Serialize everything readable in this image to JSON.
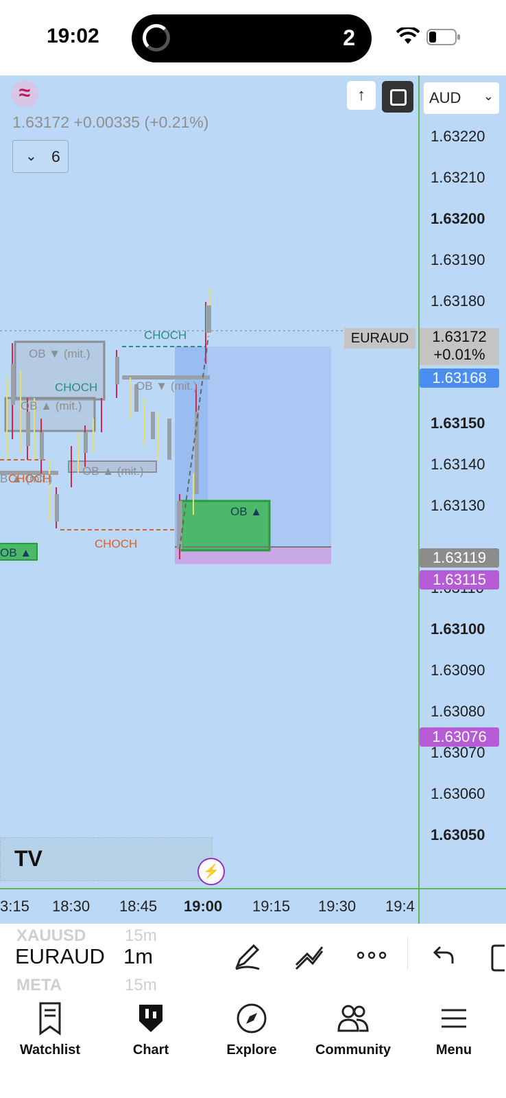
{
  "status": {
    "time": "19:02",
    "notification_count": "2"
  },
  "header": {
    "quote": "1.63172  +0.00335 (+0.21%)",
    "indicator_count": "6",
    "currency": "AUD",
    "up_arrow": "↑"
  },
  "price_axis": {
    "ticks": [
      {
        "label": "1.63220",
        "bold": false
      },
      {
        "label": "1.63210",
        "bold": false
      },
      {
        "label": "1.63200",
        "bold": true
      },
      {
        "label": "1.63190",
        "bold": false
      },
      {
        "label": "1.63180",
        "bold": false
      },
      {
        "label": "1.63150",
        "bold": true
      },
      {
        "label": "1.63140",
        "bold": false
      },
      {
        "label": "1.63130",
        "bold": false
      },
      {
        "label": "1.63110",
        "bold": false
      },
      {
        "label": "1.63100",
        "bold": true
      },
      {
        "label": "1.63090",
        "bold": false
      },
      {
        "label": "1.63080",
        "bold": false
      },
      {
        "label": "1.63070",
        "bold": false
      },
      {
        "label": "1.63060",
        "bold": false
      },
      {
        "label": "1.63050",
        "bold": true
      }
    ],
    "current_price": "1.63172",
    "current_change": "+0.01%",
    "symbol_label": "EURAUD",
    "labels": [
      {
        "value": "1.63168",
        "color": "#4a8ef0"
      },
      {
        "value": "1.63119",
        "color": "#8c8c8c"
      },
      {
        "value": "1.63115",
        "color": "#b65bd6"
      },
      {
        "value": "1.63076",
        "color": "#b65bd6"
      }
    ]
  },
  "time_axis": [
    "3:15",
    "18:30",
    "18:45",
    "19:00",
    "19:15",
    "19:30",
    "19:4"
  ],
  "annotations": {
    "ob_mit_bear": "OB ▼ (mit.)",
    "ob_mit_bull": "OB ▲ (mit.)",
    "ob_mit_bear_2": "OB ▼ (mit.)",
    "ob_mit_bull_2": "OB ▲ (mit.)",
    "ob_mit_bull_3": "B ▲ (mit.)",
    "choch_top": "CHOCH",
    "choch_mid": "CHOCH",
    "choch_left": "CHOCH",
    "choch_bottom": "CHOCH",
    "ob_green": "OB ▲",
    "ob_green_left": "OB ▲"
  },
  "branding": {
    "tv": "TV"
  },
  "symbols": {
    "prev": "XAUUSD",
    "prev_tf": "15m",
    "current": "EURAUD",
    "current_tf": "1m",
    "next": "META",
    "next_tf": "15m"
  },
  "tabs": [
    "Watchlist",
    "Chart",
    "Explore",
    "Community",
    "Menu"
  ]
}
